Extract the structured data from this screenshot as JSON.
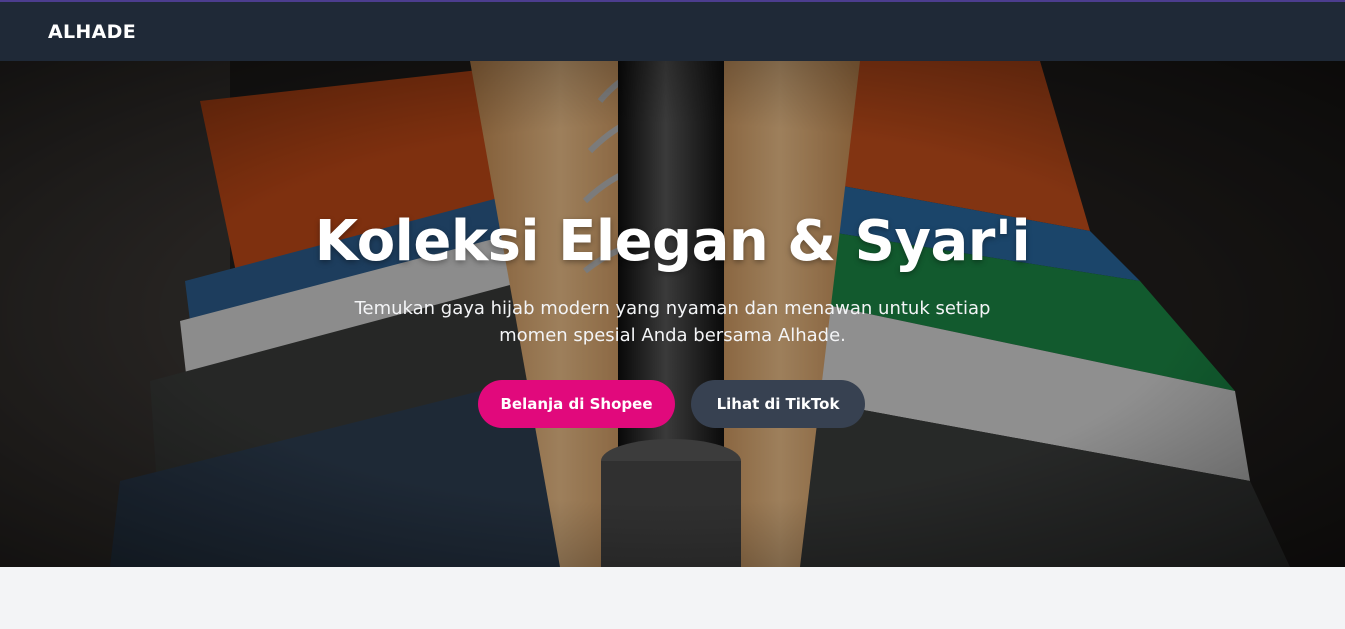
{
  "navbar": {
    "brand": "ALHADE"
  },
  "hero": {
    "background_image": "clothes-on-hangers-photo",
    "title": "Koleksi Elegan & Syar'i",
    "subtitle": "Temukan gaya hijab modern yang nyaman dan menawan untuk setiap momen spesial Anda bersama Alhade.",
    "buttons": {
      "shopee_label": "Belanja di Shopee",
      "tiktok_label": "Lihat di TikTok"
    }
  },
  "colors": {
    "navbar": "#1f2937",
    "shopee_button": "#e1097c",
    "tiktok_button": "#374151",
    "page_background": "#f3f4f6"
  }
}
